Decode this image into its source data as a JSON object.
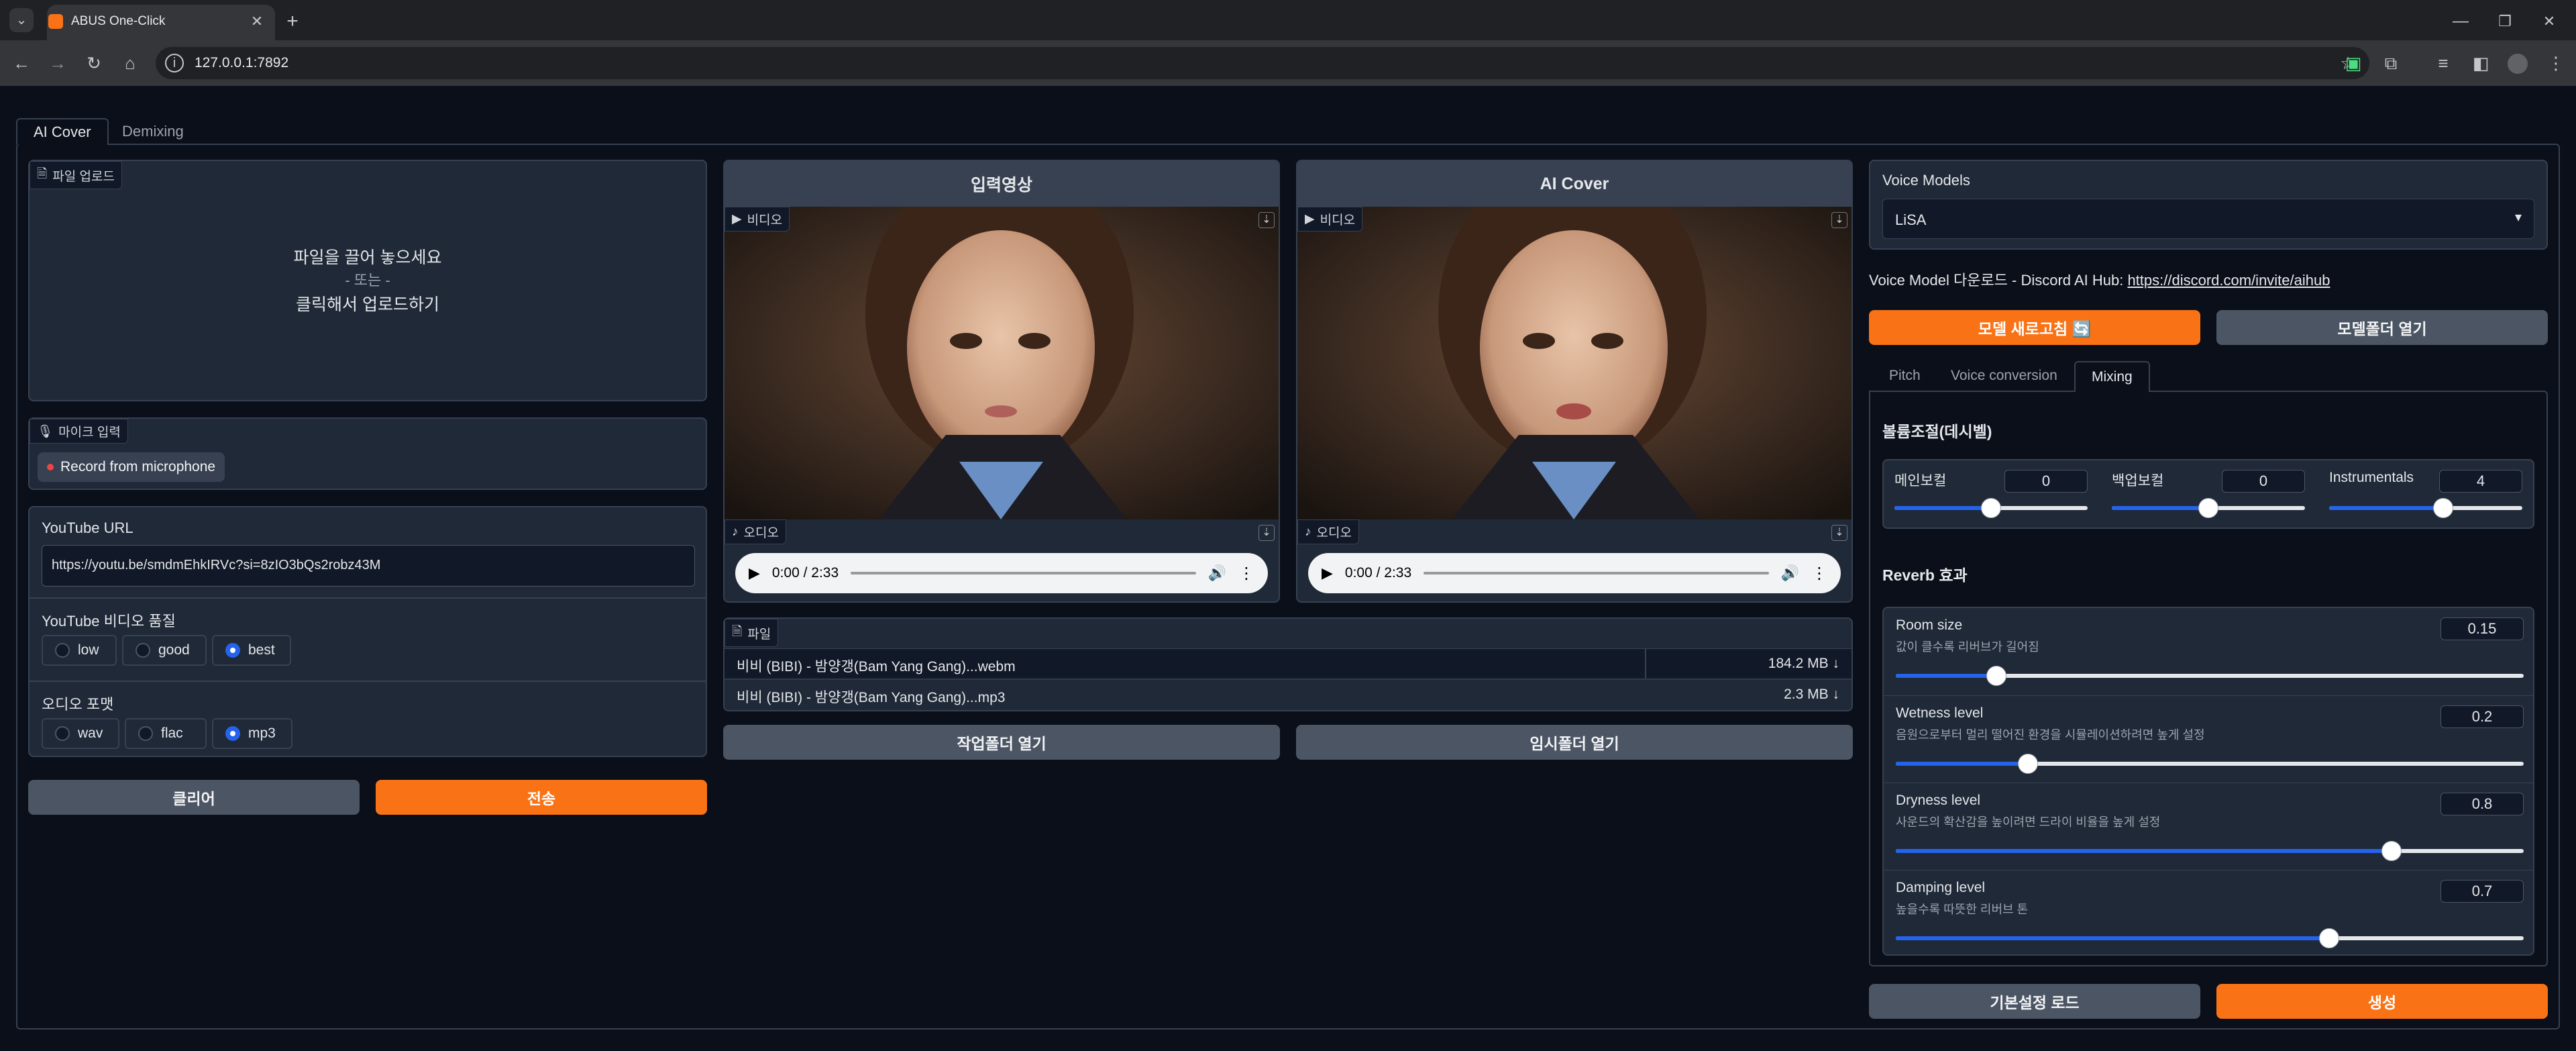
{
  "browser": {
    "tab_title": "ABUS One-Click",
    "url": "127.0.0.1:7892"
  },
  "tabs": [
    "AI Cover",
    "Demixing"
  ],
  "upload": {
    "label": "파일 업로드",
    "drop_text": "파일을 끌어 놓으세요",
    "or_text": "- 또는 -",
    "click_text": "클릭해서 업로드하기"
  },
  "mic": {
    "label": "마이크 입력",
    "button": "Record from microphone"
  },
  "youtube": {
    "url_label": "YouTube URL",
    "url_value": "https://youtu.be/smdmEhkIRVc?si=8zIO3bQs2robz43M",
    "quality_label": "YouTube 비디오 품질",
    "quality_options": [
      "low",
      "good",
      "best"
    ],
    "quality_selected": "best",
    "format_label": "오디오 포맷",
    "format_options": [
      "wav",
      "flac",
      "mp3"
    ],
    "format_selected": "mp3"
  },
  "left_buttons": {
    "clear": "클리어",
    "submit": "전송"
  },
  "input_video": {
    "title": "입력영상",
    "video_label": "비디오",
    "audio_label": "오디오",
    "time": "0:00 / 2:33"
  },
  "ai_cover": {
    "title": "AI Cover",
    "video_label": "비디오",
    "audio_label": "오디오",
    "time": "0:00 / 2:33"
  },
  "files": {
    "label": "파일",
    "rows": [
      {
        "name": "비비 (BIBI) - 밤양갱(Bam Yang Gang)...webm",
        "size": "184.2 MB ↓"
      },
      {
        "name": "비비 (BIBI) - 밤양갱(Bam Yang Gang)...mp3",
        "size": "2.3 MB ↓"
      }
    ]
  },
  "mid_buttons": {
    "work_folder": "작업폴더 열기",
    "temp_folder": "임시폴더 열기"
  },
  "voice_models": {
    "label": "Voice Models",
    "selected": "LiSA",
    "download_prefix": "Voice Model 다운로드 - Discord AI Hub: ",
    "download_link": "https://discord.com/invite/aihub",
    "refresh_button": "모델 새로고침 🔄",
    "open_folder_button": "모델폴더 열기"
  },
  "settings_tabs": [
    "Pitch",
    "Voice conversion",
    "Mixing"
  ],
  "mixing": {
    "volume_title": "볼륨조절(데시벨)",
    "volumes": [
      {
        "label": "메인보컬",
        "value": "0",
        "fraction": 0.5
      },
      {
        "label": "백업보컬",
        "value": "0",
        "fraction": 0.5
      },
      {
        "label": "Instrumentals",
        "value": "4",
        "fraction": 0.59
      }
    ],
    "reverb_title": "Reverb 효과",
    "reverb": [
      {
        "label": "Room size",
        "desc": "값이 클수록 리버브가 길어짐",
        "value": "0.15",
        "fraction": 0.16
      },
      {
        "label": "Wetness level",
        "desc": "음원으로부터 멀리 떨어진 환경을 시뮬레이션하려면 높게 설정",
        "value": "0.2",
        "fraction": 0.21
      },
      {
        "label": "Dryness level",
        "desc": "사운드의 확산감을 높이려면 드라이 비율을 높게 설정",
        "value": "0.8",
        "fraction": 0.79
      },
      {
        "label": "Damping level",
        "desc": "높을수록 따뜻한 리버브 톤",
        "value": "0.7",
        "fraction": 0.69
      }
    ]
  },
  "bottom_buttons": {
    "defaults": "기본설정 로드",
    "generate": "생성"
  }
}
